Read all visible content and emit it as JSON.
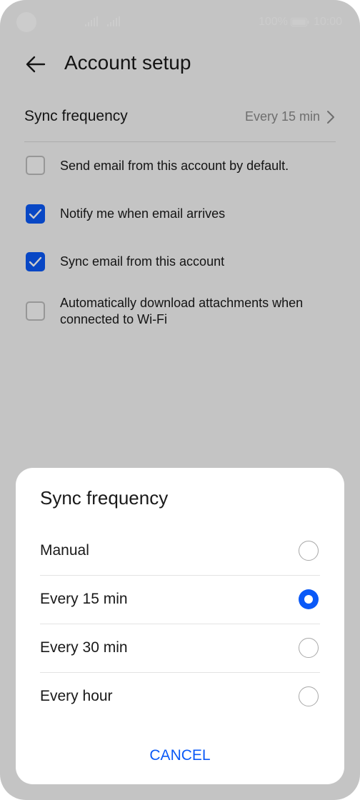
{
  "status_bar": {
    "battery": "100%",
    "time": "10:00"
  },
  "header": {
    "title": "Account setup"
  },
  "sync": {
    "label": "Sync frequency",
    "value": "Every 15 min"
  },
  "settings": [
    {
      "label": "Send email from this account by default.",
      "checked": false
    },
    {
      "label": "Notify me when email arrives",
      "checked": true
    },
    {
      "label": "Sync email from this account",
      "checked": true
    },
    {
      "label": "Automatically download attachments when connected to Wi-Fi",
      "checked": false
    }
  ],
  "dialog": {
    "title": "Sync frequency",
    "options": [
      {
        "label": "Manual",
        "selected": false
      },
      {
        "label": "Every 15 min",
        "selected": true
      },
      {
        "label": "Every 30 min",
        "selected": false
      },
      {
        "label": "Every hour",
        "selected": false
      }
    ],
    "cancel_label": "CANCEL"
  },
  "colors": {
    "accent": "#0a59f7"
  }
}
